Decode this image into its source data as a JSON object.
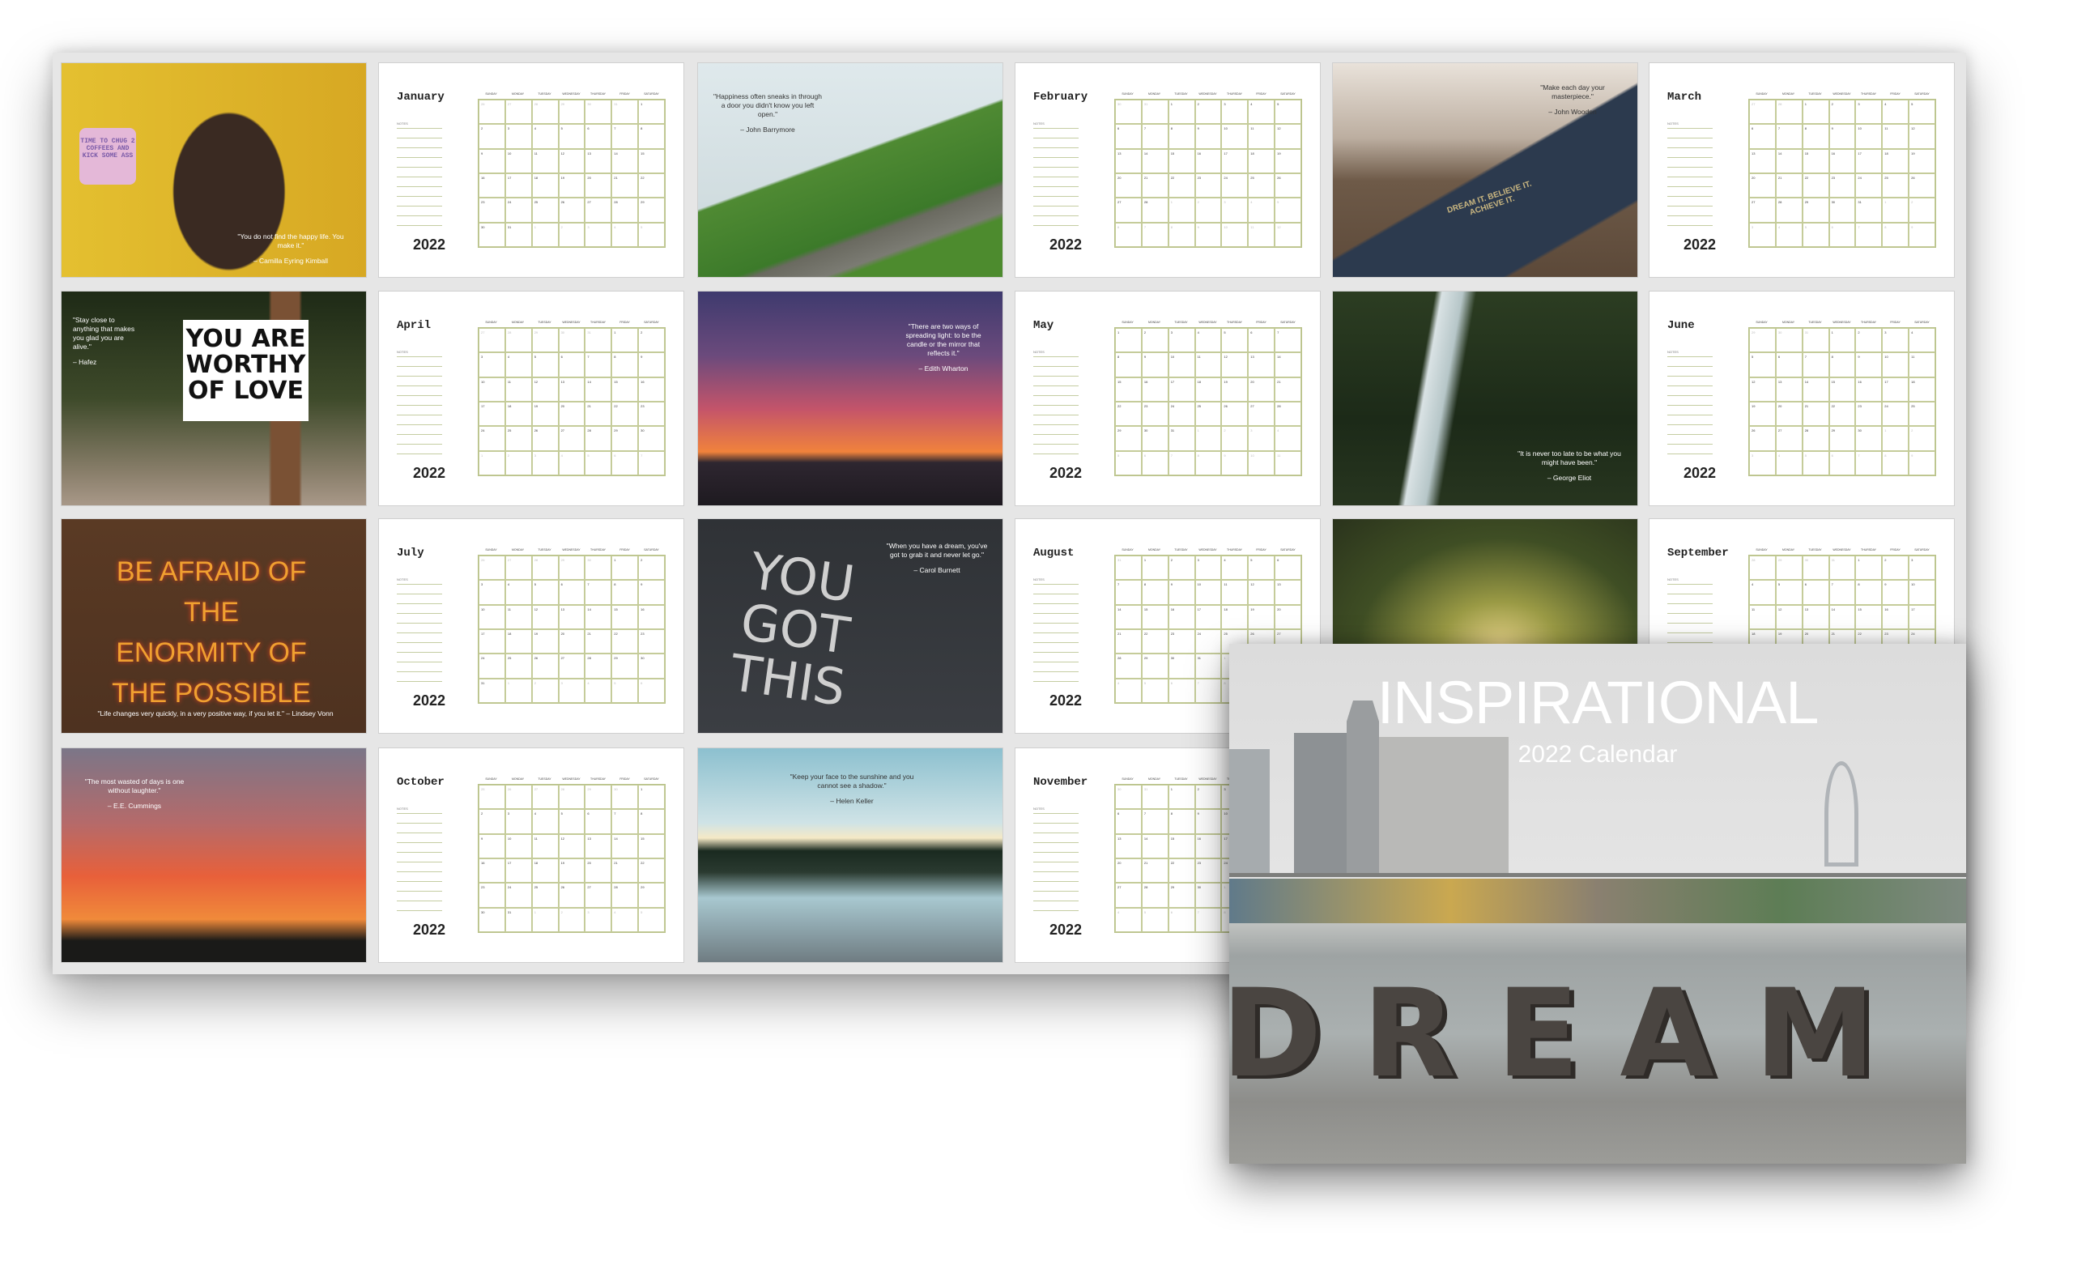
{
  "year": "2022",
  "notes_label": "NOTES",
  "weekdays": [
    "SUNDAY",
    "MONDAY",
    "TUESDAY",
    "WEDNESDAY",
    "THURSDAY",
    "FRIDAY",
    "SATURDAY"
  ],
  "pages": [
    {
      "type": "photo",
      "scene": "woman-yellow",
      "quote": "\"You do not find the happy life. You make it.\"",
      "author": "– Camilla Eyring Kimball",
      "sign": "TIME TO CHUG 2 COFFEES AND KICK SOME ASS"
    },
    {
      "type": "month",
      "name": "January",
      "index": 0
    },
    {
      "type": "photo",
      "scene": "green-hills",
      "quote": "\"Happiness often sneaks in through a door you didn't know you left open.\"",
      "author": "– John Barrymore"
    },
    {
      "type": "month",
      "name": "February",
      "index": 1
    },
    {
      "type": "photo",
      "scene": "glasses-book",
      "quote": "\"Make each day your masterpiece.\"",
      "author": "– John Wooden",
      "sign": "DREAM IT. BELIEVE IT. ACHIEVE IT."
    },
    {
      "type": "month",
      "name": "March",
      "index": 2
    },
    {
      "type": "photo",
      "scene": "worthy-sign",
      "quote": "\"Stay close to anything that makes you glad you are alive.\"",
      "author": "– Hafez",
      "sign": "YOU ARE WORTHY OF LOVE"
    },
    {
      "type": "month",
      "name": "April",
      "index": 3
    },
    {
      "type": "photo",
      "scene": "purple-sunset",
      "quote": "\"There are two ways of spreading light: to be the candle or the mirror that reflects it.\"",
      "author": "– Edith Wharton"
    },
    {
      "type": "month",
      "name": "May",
      "index": 4
    },
    {
      "type": "photo",
      "scene": "waterfall",
      "quote": "\"It is never too late to be what you might have been.\"",
      "author": "– George Eliot"
    },
    {
      "type": "month",
      "name": "June",
      "index": 5
    },
    {
      "type": "photo",
      "scene": "neon",
      "quote": "\"Life changes very quickly, in a very positive way, if you let it.\" – Lindsey Vonn",
      "author": "",
      "sign": "BE AFRAID OF THE ENORMITY OF THE POSSIBLE"
    },
    {
      "type": "month",
      "name": "July",
      "index": 6
    },
    {
      "type": "photo",
      "scene": "chalk",
      "quote": "\"When you have a dream, you've got to grab it and never let go.\"",
      "author": "– Carol Burnett",
      "sign": "YOU GOT THIS"
    },
    {
      "type": "month",
      "name": "August",
      "index": 7
    },
    {
      "type": "photo",
      "scene": "forest-light",
      "quote": "",
      "author": ""
    },
    {
      "type": "month",
      "name": "September",
      "index": 8
    },
    {
      "type": "photo",
      "scene": "red-sky",
      "quote": "\"The most wasted of days is one without laughter.\"",
      "author": "– E.E. Cummings"
    },
    {
      "type": "month",
      "name": "October",
      "index": 9
    },
    {
      "type": "photo",
      "scene": "lake-dock",
      "quote": "\"Keep your face to the sunshine and you cannot see a shadow.\"",
      "author": "– Helen Keller"
    },
    {
      "type": "month",
      "name": "November",
      "index": 10
    }
  ],
  "cover": {
    "title": "INSPIRATIONAL",
    "subtitle": "2022 Calendar",
    "word": "DREAM"
  }
}
